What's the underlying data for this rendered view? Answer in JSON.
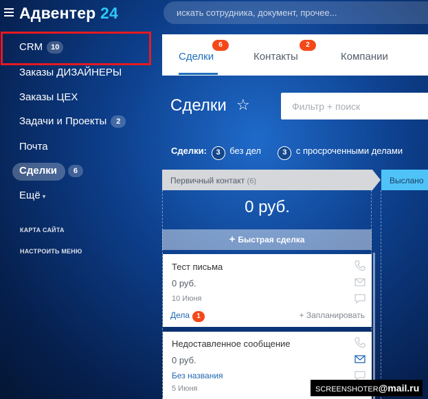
{
  "header": {
    "logo_text": "Адвентер",
    "logo_number": "24",
    "search_placeholder": "искать сотрудника, документ, прочее..."
  },
  "sidebar": {
    "items": [
      {
        "label": "CRM",
        "badge": "10"
      },
      {
        "label": "Заказы ДИЗАЙНЕРЫ"
      },
      {
        "label": "Заказы ЦЕХ"
      },
      {
        "label": "Задачи и Проекты",
        "badge": "2"
      },
      {
        "label": "Почта"
      },
      {
        "label": "Сделки",
        "badge": "6"
      },
      {
        "label": "Ещё"
      }
    ],
    "sitemap": "КАРТА САЙТА",
    "configure": "НАСТРОИТЬ МЕНЮ"
  },
  "tabs": [
    {
      "label": "Сделки",
      "counter": "6"
    },
    {
      "label": "Контакты",
      "counter": "2"
    },
    {
      "label": "Компании"
    }
  ],
  "page": {
    "title": "Сделки",
    "filter_placeholder": "Фильтр + поиск"
  },
  "counters": {
    "label": "Сделки:",
    "no_deals_count": "3",
    "no_deals_text": "без дел",
    "overdue_count": "3",
    "overdue_text": "с просроченными делами"
  },
  "stages": [
    {
      "name": "Первичный контакт",
      "count": "(6)",
      "sum": "0 руб."
    },
    {
      "name": "Выслано"
    }
  ],
  "quick_deal": "Быстрая сделка",
  "cards": [
    {
      "title": "Тест письма",
      "sum": "0 руб.",
      "date": "10 Июня",
      "link": "Дела",
      "link_badge": "1",
      "plan": "+ Запланировать"
    },
    {
      "title": "Недоставленное сообщение",
      "sum": "0 руб.",
      "date": "5 Июня",
      "link": "Без названия"
    }
  ],
  "watermark": {
    "prefix": "SCREENSHOTER",
    "at": "@",
    "suffix": "mail.ru"
  },
  "colors": {
    "accent": "#1e6fbd",
    "counter": "#f54819",
    "highlight": "#e8191f",
    "logo_number": "#2fc7f7"
  }
}
